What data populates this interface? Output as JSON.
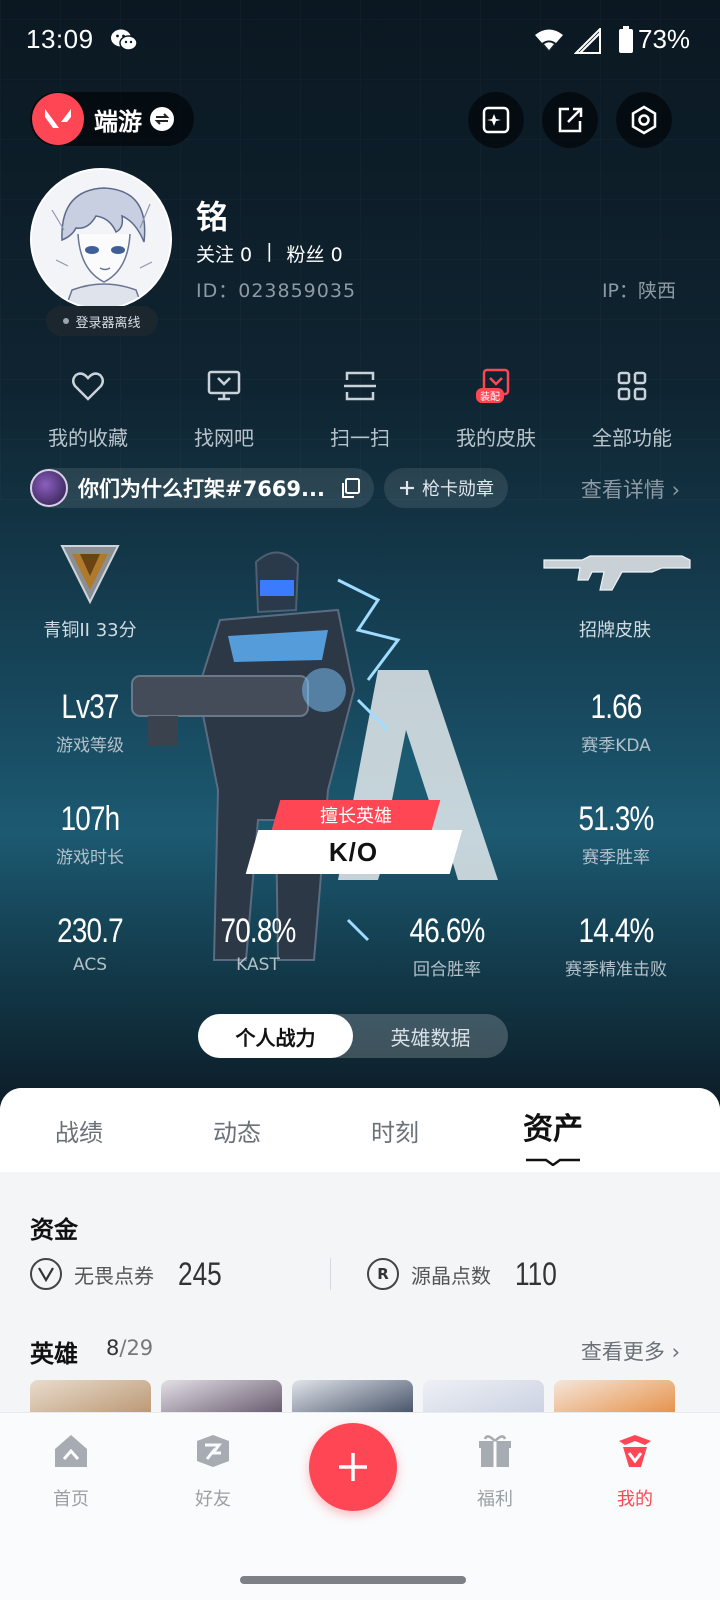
{
  "status_bar": {
    "time": "13:09",
    "battery": "73%"
  },
  "header": {
    "game_name": "端游"
  },
  "profile": {
    "name": "铭",
    "follow_label": "关注 0",
    "separator": "|",
    "fans_label": "粉丝 0",
    "id_text": "ID：023859035",
    "ip_text": "IP：陕西",
    "status_badge": "登录器离线"
  },
  "features": [
    {
      "label": "我的收藏",
      "icon": "heart-icon"
    },
    {
      "label": "找网吧",
      "icon": "monitor-icon"
    },
    {
      "label": "扫一扫",
      "icon": "scan-icon"
    },
    {
      "label": "我的皮肤",
      "icon": "skin-icon",
      "tag": "装配"
    },
    {
      "label": "全部功能",
      "icon": "grid-icon"
    }
  ],
  "riot": {
    "name": "你们为什么打架#7669...",
    "card_badge": "枪卡勋章",
    "view_detail": "查看详情"
  },
  "stats": {
    "rank": "青铜II 33分",
    "skin": "招牌皮肤",
    "level": {
      "value": "Lv37",
      "label": "游戏等级"
    },
    "kda": {
      "value": "1.66",
      "label": "赛季KDA"
    },
    "playtime": {
      "value": "107h",
      "label": "游戏时长"
    },
    "winrate": {
      "value": "51.3%",
      "label": "赛季胜率"
    },
    "acs": {
      "value": "230.7",
      "label": "ACS"
    },
    "kast": {
      "value": "70.8%",
      "label": "KAST"
    },
    "round_win": {
      "value": "46.6%",
      "label": "回合胜率"
    },
    "precision": {
      "value": "14.4%",
      "label": "赛季精准击败"
    },
    "best_hero_label": "擅长英雄",
    "best_hero_name": "K/O"
  },
  "toggle": {
    "active": "个人战力",
    "other": "英雄数据"
  },
  "tabs": [
    "战绩",
    "动态",
    "时刻",
    "资产"
  ],
  "assets": {
    "funds_title": "资金",
    "vp": {
      "name": "无畏点券",
      "value": "245"
    },
    "rp": {
      "name": "源晶点数",
      "value": "110"
    },
    "heroes_title": "英雄",
    "heroes_owned": "8",
    "heroes_total": "/29",
    "see_more": "查看更多"
  },
  "bottom_nav": [
    {
      "label": "首页",
      "icon": "home-icon"
    },
    {
      "label": "好友",
      "icon": "friends-icon"
    },
    {
      "label": "福利",
      "icon": "gift-icon"
    },
    {
      "label": "我的",
      "icon": "me-icon"
    }
  ],
  "colors": {
    "accent": "#ff4655",
    "bg_dark": "#0f2431",
    "sheet": "#f4f5f7"
  }
}
